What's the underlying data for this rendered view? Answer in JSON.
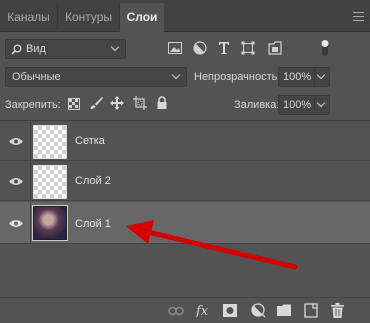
{
  "tabs": [
    {
      "label": "Каналы",
      "active": false
    },
    {
      "label": "Контуры",
      "active": false
    },
    {
      "label": "Слои",
      "active": true
    }
  ],
  "filter": {
    "value": "Вид"
  },
  "filter_icons": [
    "image-filter-icon",
    "adjustment-filter-icon",
    "type-filter-icon",
    "shape-filter-icon",
    "smart-object-filter-icon"
  ],
  "blend": {
    "mode": "Обычные",
    "opacity_label": "Непрозрачность:",
    "opacity_value": "100%"
  },
  "lock": {
    "label": "Закрепить:",
    "fill_label": "Заливка:",
    "fill_value": "100%"
  },
  "layers": [
    {
      "name": "Сетка",
      "visible": true,
      "selected": false,
      "thumb": "transparent"
    },
    {
      "name": "Слой 2",
      "visible": true,
      "selected": false,
      "thumb": "transparent"
    },
    {
      "name": "Слой 1",
      "visible": true,
      "selected": true,
      "thumb": "photo"
    }
  ],
  "annotation": {
    "arrow_color": "#d40000"
  },
  "bottom_icons": [
    "link-icon",
    "fx-icon",
    "mask-icon",
    "adjustment-layer-icon",
    "group-folder-icon",
    "new-layer-icon",
    "trash-icon"
  ]
}
